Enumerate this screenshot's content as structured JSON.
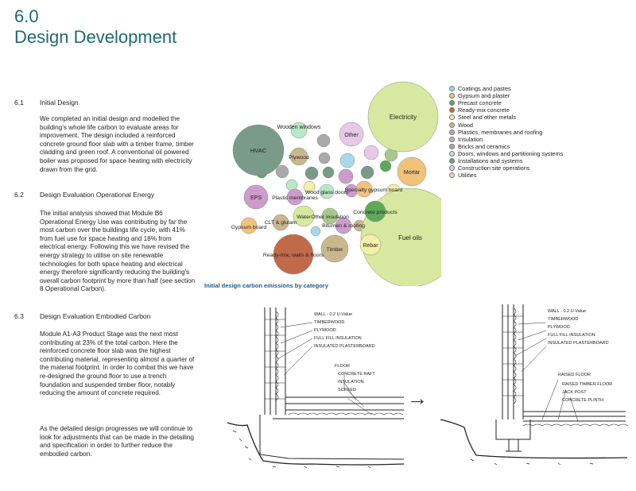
{
  "header": {
    "number": "6.0",
    "title": "Design Development"
  },
  "sections": [
    {
      "number": "6.1",
      "title": "Initial Design",
      "paragraphs": [
        "We completed an initial design and modelled the building’s whole life carbon to evaluate areas for improvement. The design included a reinforced concrete ground floor slab with a timber frame, timber cladding and green roof. A conventional oil powered boiler was proposed for space heating with electricity drawn from the grid."
      ]
    },
    {
      "number": "6.2",
      "title": "Design Evaluation Operational Energy",
      "paragraphs": [
        "The initial analysis showed that Module B6 Operational Energy Use was contributing by far the most carbon over the buildings life cycle, with 41% from fuel use for space heating and 18% from electrical energy. Following this we have revised the energy strategy to utilise on site renewable technologies for both space heating and electrical energy therefore significantly reducing the building’s overall carbon footprint by more than half (see section 8 Operational Carbon)."
      ]
    },
    {
      "number": "6.3",
      "title": "Design Evaluation Embodied Carbon",
      "paragraphs": [
        "Module A1-A3 Product Stage was the next most contributing at 23% of the total carbon. Here the reinforced concrete floor slab was the highest contributing material, representing almost a quarter of the material footprint. In order to combat this we have re-designed the ground floor to use a trench foundation and suspended timber floor, notably reducing the amount of concrete required.",
        "As the detailed design progresses we will continue to look for adjustments that can be made in the detailing and specification in order to further reduce the embodied carbon."
      ]
    }
  ],
  "chart_data": {
    "type": "bubble",
    "title": "Initial design carbon emissions by category",
    "legend": {
      "position": "right",
      "entries": [
        {
          "name": "Coatings and pastes",
          "color": "#a8d8e8"
        },
        {
          "name": "Gypsum and plaster",
          "color": "#f2c27a"
        },
        {
          "name": "Precast concrete",
          "color": "#5aaa5a"
        },
        {
          "name": "Ready-mix concrete",
          "color": "#c06a4a"
        },
        {
          "name": "Steel and other metals",
          "color": "#f3f0a8"
        },
        {
          "name": "Wood",
          "color": "#c8b88c"
        },
        {
          "name": "Plastics, membranes and roofing",
          "color": "#cc9ccc"
        },
        {
          "name": "Insulation",
          "color": "#a8c88c"
        },
        {
          "name": "Bricks and ceramics",
          "color": "#aaaaaa"
        },
        {
          "name": "Doors, windows and partitioning systems",
          "color": "#b8e8c8"
        },
        {
          "name": "Installations and systems",
          "color": "#7a9a8a"
        },
        {
          "name": "Construction site operations",
          "color": "#e8c8e8"
        },
        {
          "name": "Utilities",
          "color": "#d8e8a0"
        }
      ]
    },
    "labelled_bubbles": [
      {
        "label": "Electricity",
        "category": "Utilities"
      },
      {
        "label": "Fuel oils",
        "category": "Utilities"
      },
      {
        "label": "HVAC",
        "category": "Installations and systems"
      },
      {
        "label": "Wooden windows",
        "category": "Doors, windows and partitioning systems"
      },
      {
        "label": "Other",
        "category": "Construction site operations"
      },
      {
        "label": "Plywood",
        "category": "Wood"
      },
      {
        "label": "Mortar",
        "category": "Gypsum and plaster"
      },
      {
        "label": "EPS",
        "category": "Plastics, membranes and roofing"
      },
      {
        "label": "Plastic membranes",
        "category": "Plastics, membranes and roofing"
      },
      {
        "label": "Wood glass doors",
        "category": "Doors, windows and partitioning systems"
      },
      {
        "label": "Specialty gypsum board",
        "category": "Gypsum and plaster"
      },
      {
        "label": "CLT & glulam",
        "category": "Wood"
      },
      {
        "label": "Water",
        "category": "Utilities"
      },
      {
        "label": "Other insulation",
        "category": "Insulation"
      },
      {
        "label": "Concrete products",
        "category": "Precast concrete"
      },
      {
        "label": "Gypsum board",
        "category": "Gypsum and plaster"
      },
      {
        "label": "Bitumen & roofing",
        "category": "Plastics, membranes and roofing"
      },
      {
        "label": "Ready-mix, walls & floors",
        "category": "Ready-mix concrete"
      },
      {
        "label": "Timber",
        "category": "Wood"
      },
      {
        "label": "Rebar",
        "category": "Steel and other metals"
      }
    ],
    "unlabelled_bubble_count": 18
  },
  "sketches": {
    "arrow": "→",
    "before": {
      "notes": [
        "WALL - 0.2 U-Value",
        "TIMBERWOOD",
        "PLYWOOD",
        "FULL FILL INSULATION",
        "INSULATED PLASTERBOARD",
        "FLOOR",
        "CONCRETE RAFT",
        "INSULATION",
        "SCREED"
      ]
    },
    "after": {
      "notes": [
        "WALL - 0.2 U-Value",
        "TIMBERWOOD",
        "PLYWOOD",
        "FULL FILL INSULATION",
        "INSULATED PLASTERBOARD",
        "RAISED FLOOR",
        "RAISED TIMBER FLOOR",
        "JACK POST",
        "CONCRETE PLINTH"
      ]
    }
  }
}
